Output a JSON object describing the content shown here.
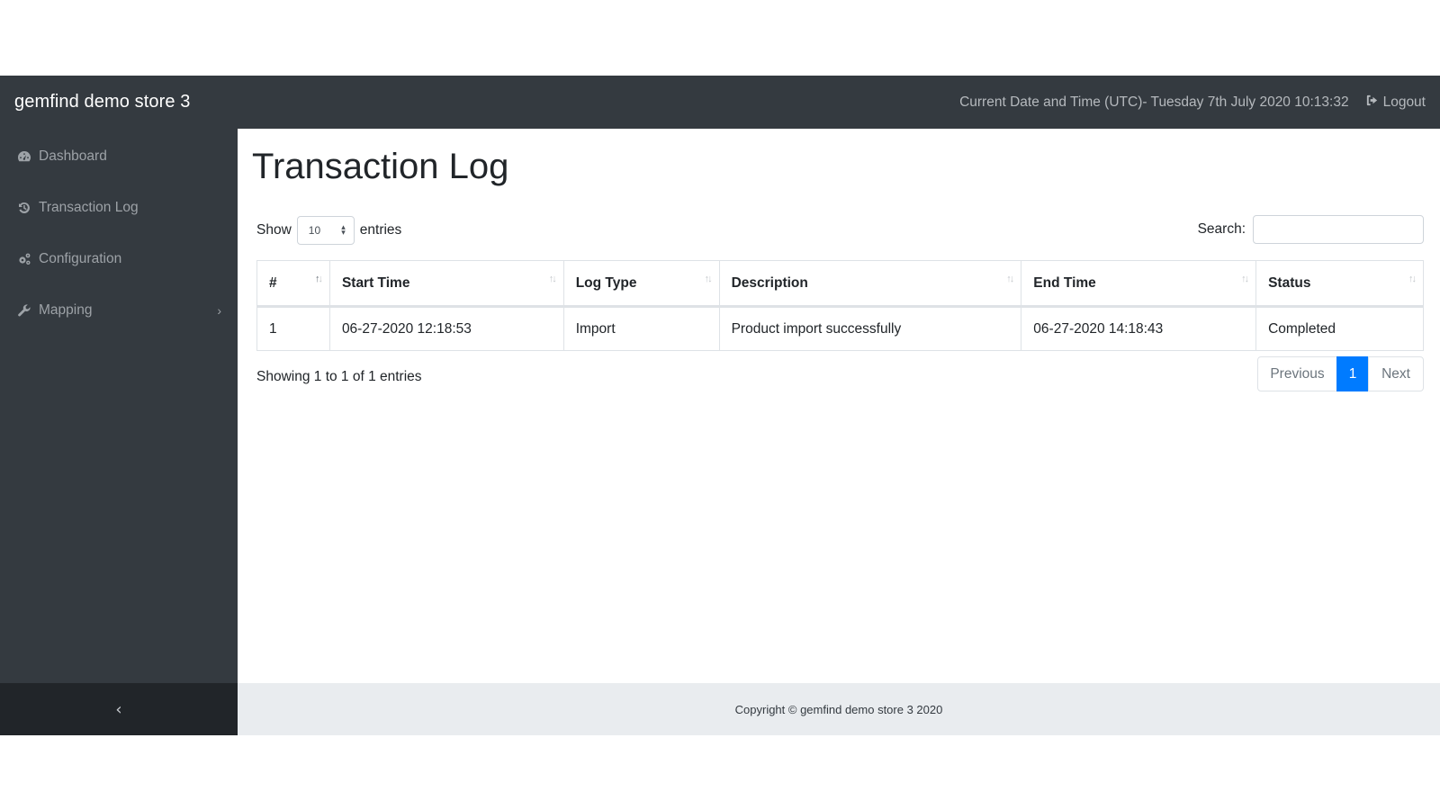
{
  "navbar": {
    "brand": "gemfind demo store 3",
    "datetime_label": "Current Date and Time (UTC)- Tuesday 7th July 2020 10:13:32",
    "logout_label": "Logout",
    "logout_icon": "sign-out-icon"
  },
  "sidebar": {
    "items": [
      {
        "label": "Dashboard",
        "icon": "tachometer-icon"
      },
      {
        "label": "Transaction Log",
        "icon": "history-icon"
      },
      {
        "label": "Configuration",
        "icon": "cogs-icon"
      },
      {
        "label": "Mapping",
        "icon": "wrench-icon",
        "has_submenu": true
      }
    ],
    "collapse_icon": "‹"
  },
  "main": {
    "title": "Transaction Log",
    "length_menu": {
      "prefix": "Show",
      "selected": "10",
      "suffix": "entries"
    },
    "search": {
      "label": "Search:",
      "value": "",
      "placeholder": ""
    },
    "table": {
      "columns": [
        "#",
        "Start Time",
        "Log Type",
        "Description",
        "End Time",
        "Status"
      ],
      "rows": [
        [
          "1",
          "06-27-2020 12:18:53",
          "Import",
          "Product import successfully",
          "06-27-2020 14:18:43",
          "Completed"
        ]
      ]
    },
    "info": "Showing 1 to 1 of 1 entries",
    "pagination": {
      "previous": "Previous",
      "current": "1",
      "next": "Next"
    }
  },
  "footer": {
    "copyright": "Copyright © gemfind demo store 3 2020"
  },
  "colors": {
    "navbar_bg": "#343a40",
    "sidebar_toggle_bg": "#212529",
    "accent": "#007bff",
    "footer_bg": "#e9ecef"
  }
}
